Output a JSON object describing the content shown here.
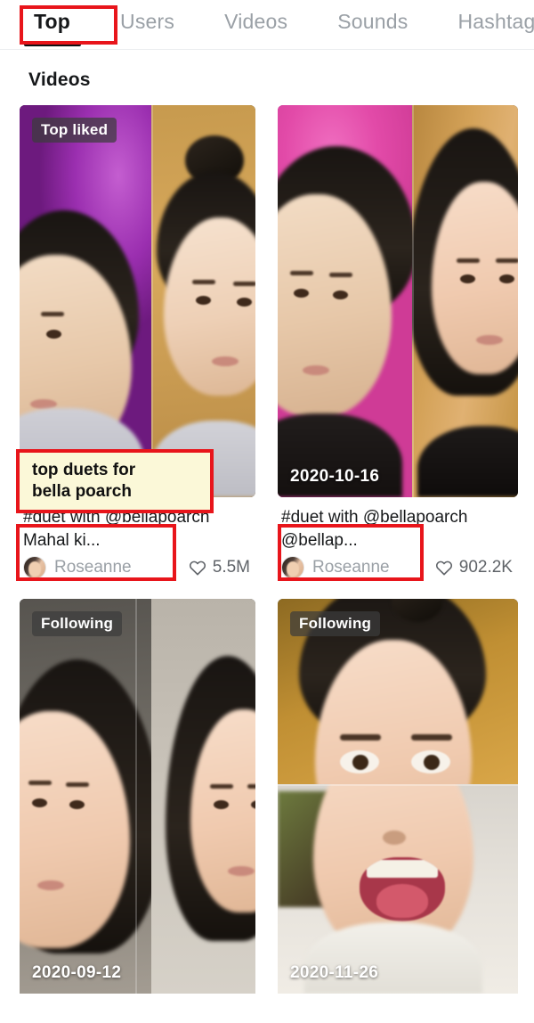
{
  "tabs": [
    {
      "label": "Top",
      "active": true
    },
    {
      "label": "Users",
      "active": false
    },
    {
      "label": "Videos",
      "active": false
    },
    {
      "label": "Sounds",
      "active": false
    },
    {
      "label": "Hashtags",
      "active": false
    }
  ],
  "section": {
    "title": "Videos"
  },
  "videos": [
    {
      "badge": "Top liked",
      "date": "",
      "caption": "#duet with @bellapoarch Mahal ki...",
      "username": "Roseanne",
      "likes": "5.5M"
    },
    {
      "badge": "",
      "date": "2020-10-16",
      "caption": "#duet with @bellapoarch @bellap...",
      "username": "Roseanne",
      "likes": "902.2K"
    },
    {
      "badge": "Following",
      "date": "2020-09-12",
      "caption": "",
      "username": "",
      "likes": ""
    },
    {
      "badge": "Following",
      "date": "2020-11-26",
      "caption": "",
      "username": "",
      "likes": ""
    }
  ],
  "annotations": {
    "highlight_color": "#e8151b",
    "note_background": "#fbf8d8",
    "note_line_1": "top duets for",
    "note_line_2": "bella poarch"
  }
}
